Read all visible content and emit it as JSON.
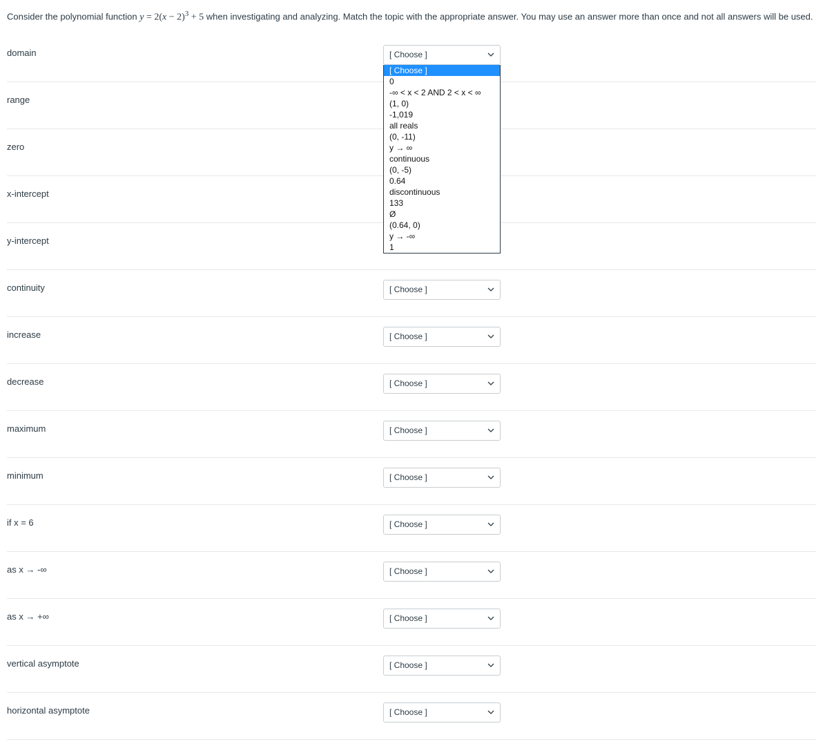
{
  "instruction": {
    "pre": "Consider the polynomial function ",
    "eq_y": "y",
    "eq_eq": " = ",
    "eq_lead": "2(",
    "eq_x": "x",
    "eq_minus": " − 2)",
    "eq_exp": "3",
    "eq_tail": " + 5",
    "post": " when investigating and analyzing.  Match the topic with the appropriate answer.  You may use an answer more than once and not all answers will be used."
  },
  "choose_label": "[ Choose ]",
  "rows": [
    {
      "id": "domain",
      "label": "domain",
      "open": true
    },
    {
      "id": "range",
      "label": "range",
      "open": false
    },
    {
      "id": "zero",
      "label": "zero",
      "open": false
    },
    {
      "id": "xintercept",
      "label": "x-intercept",
      "open": false
    },
    {
      "id": "yintercept",
      "label": "y-intercept",
      "open": false
    },
    {
      "id": "continuity",
      "label": "continuity",
      "open": false
    },
    {
      "id": "increase",
      "label": "increase",
      "open": false
    },
    {
      "id": "decrease",
      "label": "decrease",
      "open": false
    },
    {
      "id": "maximum",
      "label": "maximum",
      "open": false
    },
    {
      "id": "minimum",
      "label": "minimum",
      "open": false
    },
    {
      "id": "ifx6",
      "label": "if x = 6",
      "open": false
    },
    {
      "id": "asxneginf",
      "label": "as x → -∞",
      "open": false
    },
    {
      "id": "asxposinf",
      "label": "as x → +∞",
      "open": false
    },
    {
      "id": "vasymptote",
      "label": "vertical asymptote",
      "open": false
    },
    {
      "id": "hasymptote",
      "label": "horizontal asymptote",
      "open": false
    }
  ],
  "options": [
    "[ Choose ]",
    "0",
    "-∞ < x < 2 AND 2 < x < ∞",
    "(1, 0)",
    "-1,019",
    "all reals",
    "(0, -11)",
    "y → ∞",
    "continuous",
    "(0, -5)",
    "0.64",
    "discontinuous",
    "133",
    "Ø",
    "(0.64, 0)",
    "y → -∞",
    "1"
  ]
}
